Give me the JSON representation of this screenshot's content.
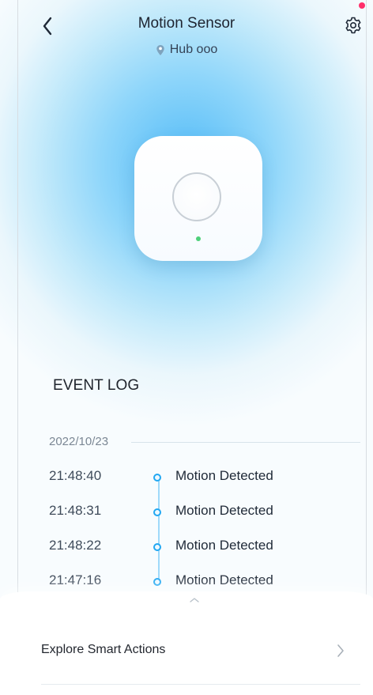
{
  "header": {
    "title": "Motion Sensor",
    "location": "Hub ooo",
    "back_icon": "chevron-left-icon",
    "settings_icon": "gear-icon",
    "location_icon": "map-pin-icon",
    "notification_color": "#ff2f6b"
  },
  "device": {
    "status_led_color": "#4dd07a"
  },
  "event_log": {
    "title": "EVENT LOG",
    "date": "2022/10/23",
    "events": [
      {
        "time": "21:48:40",
        "label": "Motion Detected"
      },
      {
        "time": "21:48:31",
        "label": "Motion Detected"
      },
      {
        "time": "21:48:22",
        "label": "Motion Detected"
      },
      {
        "time": "21:47:16",
        "label": "Motion Detected"
      }
    ]
  },
  "bottom_sheet": {
    "handle_icon": "chevron-up-icon",
    "explore_label": "Explore Smart Actions",
    "explore_icon": "chevron-right-icon"
  },
  "colors": {
    "accent": "#21a7f2",
    "timeline": "#9fd9fa"
  }
}
